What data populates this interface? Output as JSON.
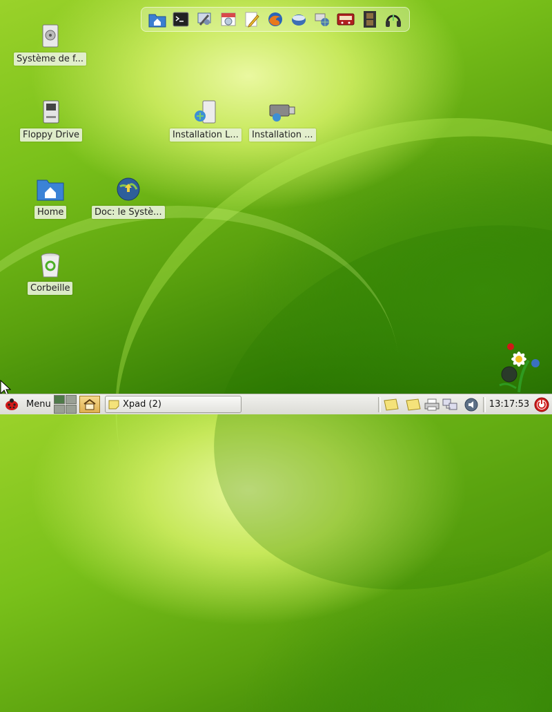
{
  "dock": {
    "items": [
      {
        "name": "home-folder-icon",
        "color": "#3b7fd1"
      },
      {
        "name": "terminal-icon",
        "color": "#2a2a2a"
      },
      {
        "name": "system-settings-icon",
        "color": "#5a7cab"
      },
      {
        "name": "app-installer-icon",
        "color": "#d84a4a"
      },
      {
        "name": "text-editor-icon",
        "color": "#f0c030"
      },
      {
        "name": "firefox-icon",
        "color": "#e87a1c"
      },
      {
        "name": "mail-icon",
        "color": "#3d6fb5"
      },
      {
        "name": "network-icon",
        "color": "#7a9ab8"
      },
      {
        "name": "media-player-icon",
        "color": "#b02020"
      },
      {
        "name": "video-icon",
        "color": "#3a3a3a"
      },
      {
        "name": "audio-icon",
        "color": "#2a2a2a"
      }
    ]
  },
  "desktop": {
    "icons": [
      {
        "label": "Système de f...",
        "icon": "hard-drive-icon"
      },
      {
        "label": "Floppy Drive",
        "icon": "floppy-drive-icon"
      },
      {
        "label": "Home",
        "icon": "home-folder-icon"
      },
      {
        "label": "Corbeille",
        "icon": "trash-icon"
      },
      {
        "label": "Installation L...",
        "icon": "install-icon"
      },
      {
        "label": "Installation ...",
        "icon": "usb-install-icon"
      },
      {
        "label": "Doc: le Systè...",
        "icon": "globe-doc-icon"
      }
    ]
  },
  "taskbar": {
    "menu_label": "Menu",
    "task_label": "Xpad (2)",
    "clock": "13:17:53"
  },
  "colors": {
    "accent": "#7cc41f",
    "taskbar_bg": "#e6e6e1",
    "power_red": "#d02020"
  }
}
